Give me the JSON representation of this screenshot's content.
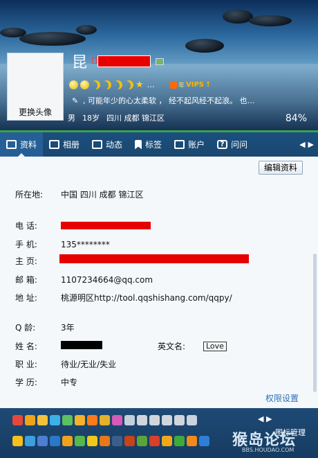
{
  "header": {
    "nickname_char": "昆",
    "avatar_change_label": "更换头像",
    "level_more": "…",
    "vip_label": "VIPS",
    "vip_year": "年",
    "signature": ", 可能年少的心太柔软 ，  经不起风经不起浪。    也…",
    "gender": "男",
    "age": "18岁",
    "location": "四川 成都 锦江区",
    "completion": "84%"
  },
  "tabs": [
    {
      "label": "资料",
      "icon": "profile-card-icon"
    },
    {
      "label": "相册",
      "icon": "photo-icon"
    },
    {
      "label": "动态",
      "icon": "feed-list-icon"
    },
    {
      "label": "标签",
      "icon": "bookmark-icon"
    },
    {
      "label": "账户",
      "icon": "briefcase-icon"
    },
    {
      "label": "问问",
      "icon": "question-icon"
    }
  ],
  "tab_arrows": {
    "left": "◀",
    "right": "▶"
  },
  "profile": {
    "edit_button": "编辑资料",
    "location_label": "所在地:",
    "location_value": "中国 四川 成都 锦江区",
    "phone_label": "电   话:",
    "mobile_label": "手   机:",
    "mobile_value": "135********",
    "homepage_label": "主   页:",
    "email_label": "邮   箱:",
    "email_value": "1107234664@qq.com",
    "address_label": "地   址:",
    "address_value": "桃源明区http://tool.qqshishang.com/qqpy/",
    "age_label": "Q    龄:",
    "age_value": "3年",
    "name_label": "姓   名:",
    "english_name_label": "英文名:",
    "english_name_value": "Love",
    "job_label": "职   业:",
    "job_value": "待业/无业/失业",
    "edu_label": "学   历:",
    "edu_value": "中专",
    "permission_link": "权限设置"
  },
  "iconbar": {
    "manage_label": "图标管理",
    "arrows": "◀ ▶"
  },
  "watermark": {
    "main": "猴岛论坛",
    "sub": "BBS.HOUDAO.COM"
  }
}
